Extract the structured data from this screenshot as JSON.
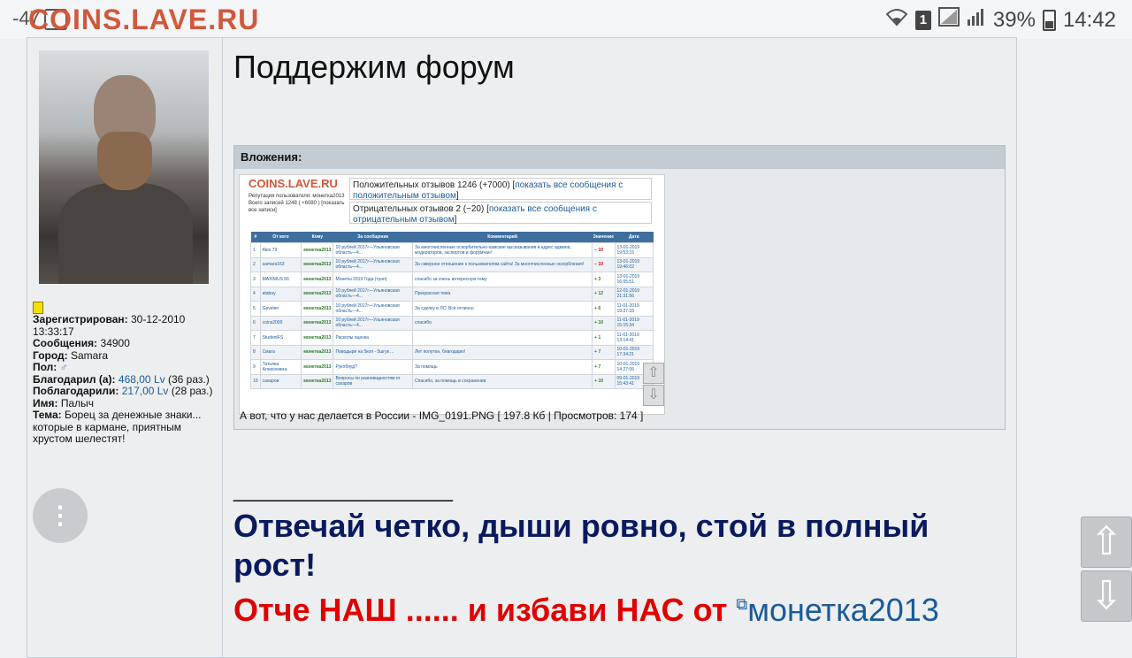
{
  "status_bar": {
    "left_text": "-47",
    "sim_label": "1",
    "battery": "39%",
    "time": "14:42"
  },
  "site": {
    "logo": "COINS.LAVE.RU"
  },
  "user": {
    "fields": [
      {
        "label": "Зарегистрирован:",
        "value": "30-12-2010 13:33:17"
      },
      {
        "label": "Сообщения:",
        "value": "34900"
      },
      {
        "label": "Город:",
        "value": "Samara"
      },
      {
        "label": "Пол:",
        "value": "♂"
      }
    ],
    "thanked_label": "Благодарил (а):",
    "thanked_amount": "468,00 Lv",
    "thanked_times": "(36 раз.)",
    "thanked_by_label": "Поблагодарили:",
    "thanked_by_amount": "217,00 Lv",
    "thanked_by_times": "(28 раз.)",
    "name_label": "Имя:",
    "name_value": "Палыч",
    "theme_label": "Тема:",
    "theme_value": "Борец за денежные знаки... которые в кармане, приятным хрустом шелестят!"
  },
  "menu_icon": "⋮",
  "post": {
    "title": "Поддержим форум",
    "attachments_header": "Вложения:",
    "attachment_caption": "А вот, что у нас делается в России - IMG_0191.PNG [ 197.8 Кб | Просмотров: 174 ]"
  },
  "thumbnail": {
    "logo": "COINS.LAVE.RU",
    "small_text": "Репутация пользователя: монетка2013 Всего записей 1248 ( +6080 ) [показать все записи]",
    "positive_text": "Положительных отзывов 1246 (+7000) [",
    "positive_link": "показать все сообщения с положительным отзывом",
    "negative_text": "Отрицательных отзывов 2 (−20) [",
    "negative_link": "показать все сообщения с отрицательным отзывом",
    "bracket_close": "]",
    "columns": [
      "#",
      "От кого",
      "Кому",
      "За сообщение",
      "Комментарий",
      "Значение",
      "Дата"
    ],
    "rows": [
      [
        "1",
        "Alex 73",
        "монетка2013",
        "10 рублей 2017г—Ульяновская область—4...",
        "За многочисленные оскорбительно-хамские высказывания в адрес админа, модераторов, экспертов и форумчан!",
        "− 10",
        "13-01-2019 19:53:15"
      ],
      [
        "2",
        "samara163",
        "монетка2013",
        "10 рублей 2017г—Ульяновская область—4...",
        "За скверное отношение к пользователям сайта! За многочисленные оскорбления!",
        "− 10",
        "13-01-2019 19:46:02"
      ],
      [
        "3",
        "MAXIMUS 56",
        "монетка2013",
        "Монеты 2019 Года (трэп)",
        "спасибо за очень интересную тему",
        "+ 3",
        "13-01-2019 16:05:51"
      ],
      [
        "4",
        "atabay",
        "монетка2013",
        "10 рублей 2017г—Ульяновская область—4...",
        "Прекрасная тема",
        "+ 12",
        "12-01-2019 21:31:56"
      ],
      [
        "5",
        "Gevelen",
        "монетка2013",
        "10 рублей 2017г—Ульяновская область—4...",
        "За сделку в ЛС! Всё отлично",
        "+ 6",
        "11-01-2019 19:27:33"
      ],
      [
        "6",
        "coins2000",
        "монетка2013",
        "10 рублей 2017г—Ульяновская область—4...",
        "спасибо",
        "+ 10",
        "11-01-2019 15:15:34"
      ],
      [
        "7",
        "StudentFS",
        "монетка2013",
        "Расколы оценка",
        "",
        "+ 1",
        "11-01-2019 13:14:41"
      ],
      [
        "8",
        "Смага",
        "монетка2013",
        "Поводыри на 5коп - 5шгук ...",
        "Лет полутон, благодарю!",
        "+ 7",
        "10-01-2019 17:34:21"
      ],
      [
        "9",
        "Татьяна Алексеевна",
        "монетка2013",
        "Рукобяуд?",
        "За помощь",
        "+ 7",
        "10-01-2019 14:27:06"
      ],
      [
        "10",
        "сахаров",
        "монетка2013",
        "Вопросы по разновидностям от сахаров",
        "Спасибо, за помощь в сохранении",
        "+ 10",
        "09-01-2019 15:43:41"
      ]
    ]
  },
  "signature": {
    "line": "____________________",
    "motto": "Отвечай четко, дыши ровно, стой в полный рост!",
    "prayer_text": "Отче НАШ ...... и избави НАС от",
    "prayer_link": "монетка2013"
  },
  "nav": {
    "up_icon": "⇧",
    "down_icon": "⇩"
  }
}
